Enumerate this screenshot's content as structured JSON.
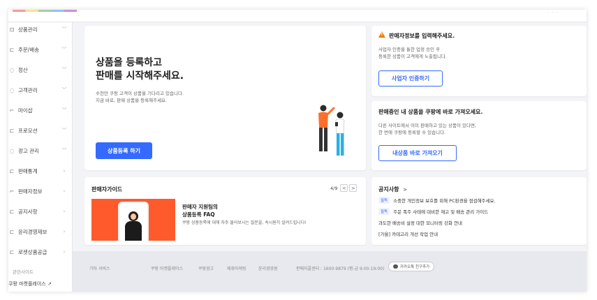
{
  "sidebar": {
    "items": [
      {
        "icon": "box-icon",
        "label": "상품관리"
      },
      {
        "icon": "cart-icon",
        "label": "주문/배송"
      },
      {
        "icon": "coin-icon",
        "label": "정산"
      },
      {
        "icon": "headset-icon",
        "label": "고객관리"
      },
      {
        "icon": "user-icon",
        "label": "마이샵"
      },
      {
        "icon": "tag-icon",
        "label": "프로모션"
      },
      {
        "icon": "megaphone-icon",
        "label": "광고 관리"
      },
      {
        "icon": "chart-icon",
        "label": "판매통계"
      },
      {
        "icon": "person-icon",
        "label": "판매자정보"
      },
      {
        "icon": "notice-icon",
        "label": "공지사항"
      },
      {
        "icon": "doc-icon",
        "label": "윤리경영제보"
      },
      {
        "icon": "truck-icon",
        "label": "로켓상품공급"
      }
    ],
    "related_label": "관련사이트",
    "marketplace_link": "쿠팡 마켓플레이스 ↗"
  },
  "hero": {
    "title_line1": "상품을 등록하고",
    "title_line2": "판매를 시작해주세요.",
    "desc_line1": "수천만 쿠팡 고객이 상품을 기다리고 있습니다.",
    "desc_line2": "지금 바로, 판매 상품을 등록해주세요.",
    "button": "상품등록 하기"
  },
  "seller_info_card": {
    "title": "판매자정보를 입력해주세요.",
    "desc_line1": "사업자 인증을 통한 업정 승인 후",
    "desc_line2": "등록한 상품이 고객에게 노출됩니다.",
    "button": "사업자 인증하기"
  },
  "import_card": {
    "title": "판매중인 내 상품을 쿠팡에 바로 가져오세요.",
    "desc_line1": "다른 사이트에서 이미 판매하고 있는 상품이 있다면,",
    "desc_line2": "한 번에 쿠팡에 등록할 수 있습니다.",
    "button": "내상품 바로 가져오기"
  },
  "guide": {
    "title": "판매자가이드",
    "page": "4/9",
    "prev": "<",
    "next": ">",
    "head_line1": "판매자 지원팀의",
    "head_line2": "상품등록 FAQ",
    "desc": "쿠팡 상품등록에 대해 자주 물어보시는 질문을, 속시원히 알려드립니다!"
  },
  "notice": {
    "title": "공지사항",
    "chevron": ">",
    "items": [
      {
        "badge": "필독",
        "text": "소중한 개인정보 보호를 위해 PC환경을 점검해주세요."
      },
      {
        "badge": "필독",
        "text": "주문 폭주 사태에 대비한 재고 및 배송 관리 가이드"
      },
      {
        "badge": "",
        "text": "과도한 배송비 설정 대한 모니터링 강화 안내"
      },
      {
        "badge": "",
        "text": "[가을] 카테고리 개선 작업 안내"
      }
    ]
  },
  "footer": {
    "items": [
      "기타 서비스",
      "쿠팡 마켓플레이스",
      "쿠팡광고",
      "제휴마케팅",
      "윤리경영원",
      "판매자콜센터 : 1600-9879 (평-금 9:00-19:00)"
    ],
    "kakao": "카카오톡 친구추가"
  }
}
